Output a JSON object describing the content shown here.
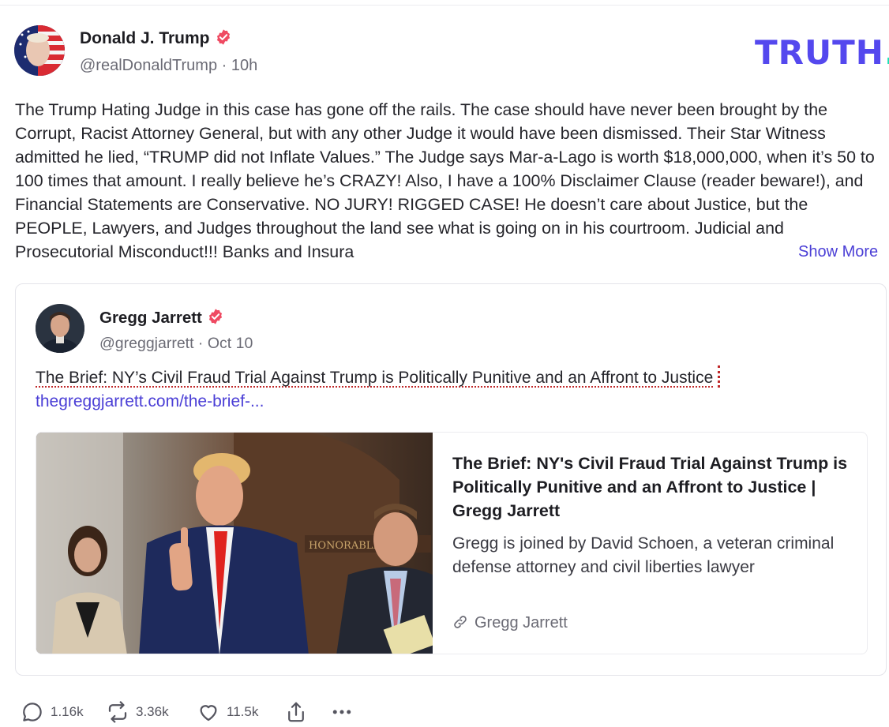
{
  "post": {
    "author_name": "Donald J. Trump",
    "handle_time": "@realDonaldTrump · 10h",
    "brand": "TRUTH",
    "brand_dot": ".",
    "text": "The Trump Hating Judge in this case has gone off the rails. The case should have never been brought by the Corrupt, Racist Attorney General, but with any other Judge it would have been dismissed. Their Star Witness admitted he lied, “TRUMP did not Inflate Values.” The Judge says Mar-a-Lago is worth $18,000,000, when it’s 50 to 100 times that amount. I really believe he’s CRAZY! Also, I have a 100% Disclaimer Clause (reader beware!), and Financial Statements are  Conservative. NO JURY! RIGGED CASE! He doesn’t care about Justice, but the PEOPLE, Lawyers, and Judges throughout the land see what is going on in his courtroom. Judicial and Prosecutorial Misconduct!!! Banks and Insura",
    "show_more": "Show More"
  },
  "quote": {
    "author_name": "Gregg Jarrett",
    "handle_time": "@greggjarrett · Oct 10",
    "text": "The Brief: NY’s Civil Fraud Trial Against Trump is Politically Punitive and an Affront to Justice",
    "link": "thegreggjarrett.com/the-brief-...",
    "preview": {
      "title": "The Brief: NY's Civil Fraud Trial Against Trump is Politically Punitive and an Affront to Justice | Gregg Jarrett",
      "description": "Gregg is joined by David Schoen, a veteran criminal defense attorney and civil liberties lawyer",
      "source": "Gregg Jarrett",
      "image_sign_text": "HONORABLE"
    }
  },
  "actions": {
    "replies": "1.16k",
    "retruths": "3.36k",
    "likes": "11.5k"
  },
  "colors": {
    "brand": "#5448ee",
    "brand_dot": "#17e2b5",
    "link": "#4b3fd6",
    "verified": "#ef4a62"
  },
  "icons": [
    "verified-badge-icon",
    "link-icon",
    "reply-icon",
    "retruth-icon",
    "heart-icon",
    "share-icon",
    "more-icon"
  ]
}
